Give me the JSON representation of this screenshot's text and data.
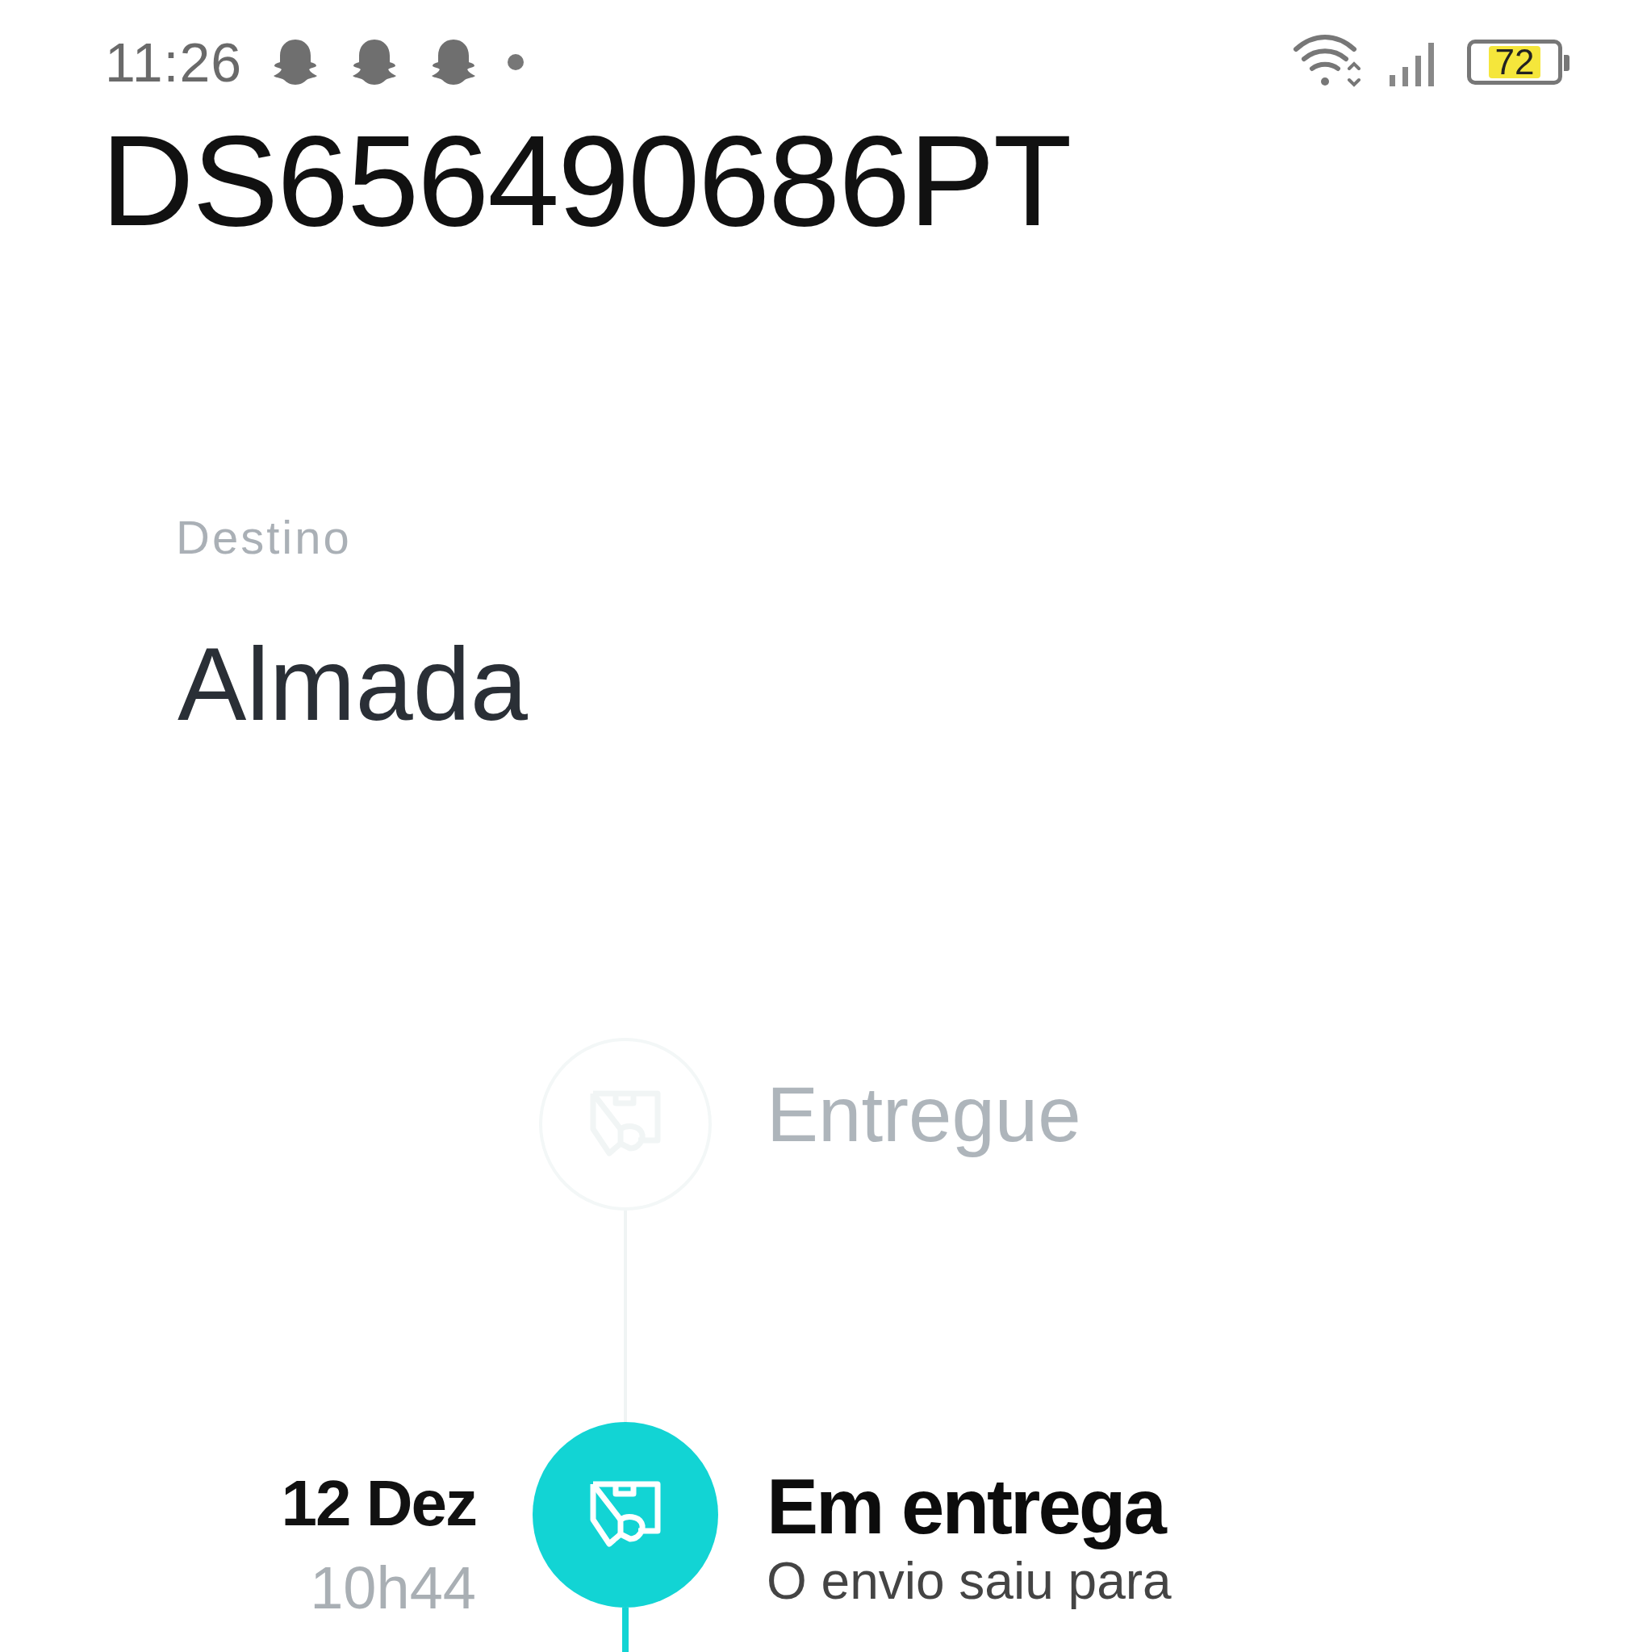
{
  "status_bar": {
    "time": "11:26",
    "notification_icons": [
      {
        "kind": "ghost"
      },
      {
        "kind": "ghost"
      },
      {
        "kind": "ghost"
      }
    ],
    "battery": "72"
  },
  "tracking_number": "DS656490686PT",
  "destination": {
    "label": "Destino",
    "value": "Almada"
  },
  "steps": [
    {
      "title": "Entregue",
      "active": false
    },
    {
      "date": "12 Dez",
      "time": "10h44",
      "title": "Em entrega",
      "description": "O envio saiu para",
      "active": true
    }
  ]
}
